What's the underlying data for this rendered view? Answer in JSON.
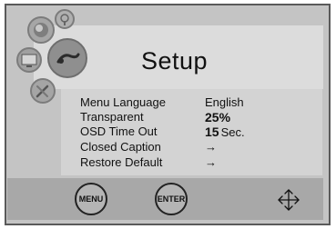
{
  "title": "Setup",
  "menu_items": [
    {
      "label": "Menu Language",
      "value": "English"
    },
    {
      "label": "Transparent",
      "value": "25%"
    },
    {
      "label": "OSD Time Out",
      "value": "15",
      "unit": "Sec."
    },
    {
      "label": "Closed Caption",
      "value": "→"
    },
    {
      "label": "Restore Default",
      "value": "→"
    }
  ],
  "buttons": {
    "menu": "MENU",
    "enter": "ENTER"
  },
  "icons": [
    "picture-icon",
    "settings-icon",
    "screen-icon",
    "tools-icon",
    "audio-icon",
    "directional-arrows-icon"
  ]
}
